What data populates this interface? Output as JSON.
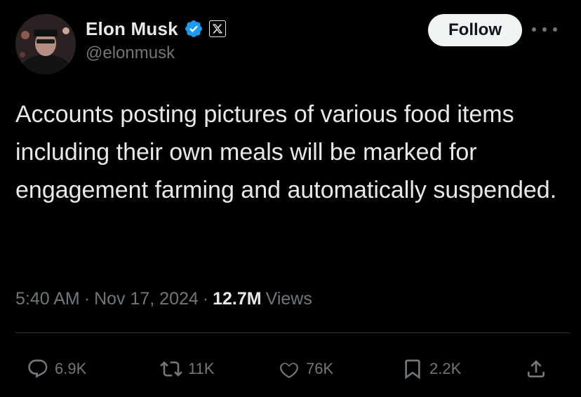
{
  "author": {
    "name": "Elon Musk",
    "handle": "@elonmusk",
    "avatar_icon": "profile-photo",
    "verified_badge_color": "#1d9bf0",
    "affiliation_badge": "x-logo"
  },
  "header": {
    "follow_label": "Follow",
    "more_icon": "ellipsis-icon"
  },
  "tweet": {
    "text": "Accounts posting pictures of various food items including their own meals will be marked for engagement farming and automatically suspended."
  },
  "meta": {
    "time": "5:40 AM",
    "separator": "·",
    "date": "Nov 17, 2024",
    "views_count": "12.7M",
    "views_label": "Views"
  },
  "actions": {
    "reply": {
      "icon": "reply-icon",
      "count": "6.9K"
    },
    "repost": {
      "icon": "repost-icon",
      "count": "11K"
    },
    "like": {
      "icon": "heart-icon",
      "count": "76K"
    },
    "bookmark": {
      "icon": "bookmark-icon",
      "count": "2.2K"
    },
    "share": {
      "icon": "share-icon"
    }
  },
  "colors": {
    "background": "#000000",
    "text_primary": "#e7e9ea",
    "text_secondary": "#71767b",
    "follow_bg": "#eff3f4"
  }
}
